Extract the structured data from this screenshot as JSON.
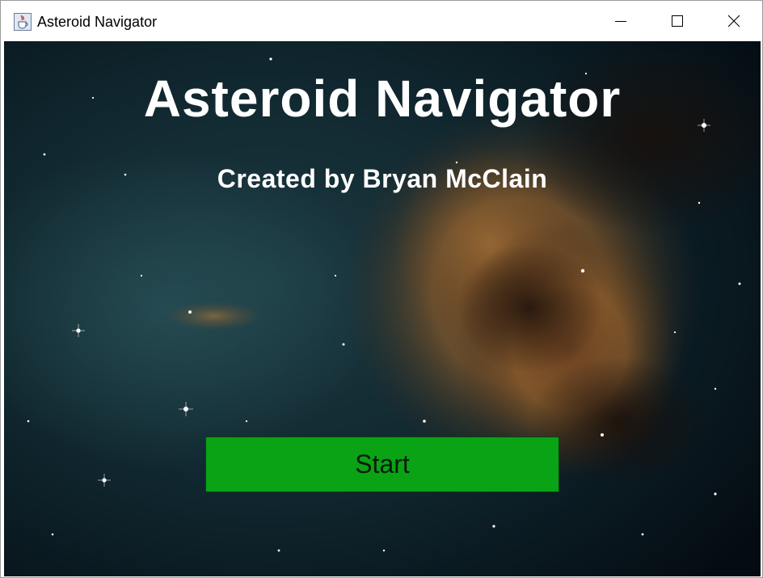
{
  "window": {
    "title": "Asteroid Navigator",
    "controls": [
      "minimize",
      "maximize",
      "close"
    ],
    "app_icon": "java-cup-icon"
  },
  "game": {
    "title": "Asteroid Navigator",
    "credit": "Created by Bryan McClain",
    "start_label": "Start",
    "background": "nebula-starfield"
  },
  "colors": {
    "start_button": "#0aa315",
    "title_text": "#ffffff",
    "space": "#06151c",
    "nebula": "#8a5a2a"
  }
}
